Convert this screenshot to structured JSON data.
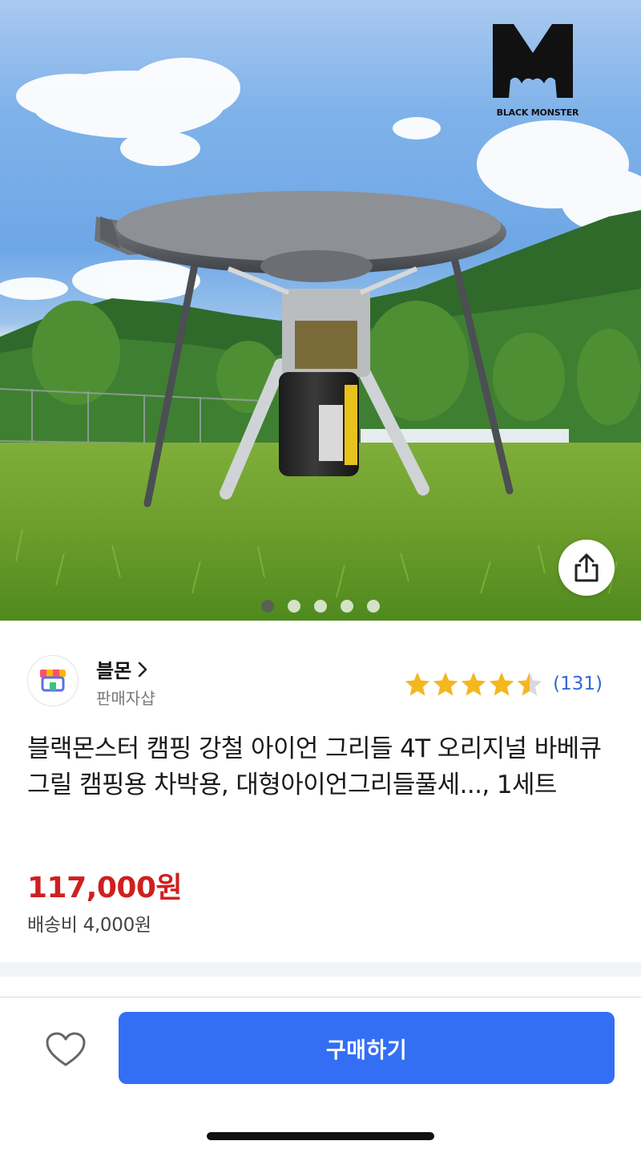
{
  "product_image": {
    "brand_logo_text": "BLACK MONSTER",
    "carousel": {
      "total": 5,
      "active_index": 0
    },
    "share_icon": "share-icon"
  },
  "seller": {
    "name": "블몬",
    "chevron": "chevron-right-icon",
    "type": "판매자샵",
    "avatar_icon": "store-icon"
  },
  "rating": {
    "score": 4.5,
    "max": 5,
    "review_count": "(131)",
    "star_color": "#f5b71f"
  },
  "product": {
    "title": "블랙몬스터 캠핑 강철 아이언 그리들 4T 오리지널 바베큐 그릴 캠핑용 차박용, 대형아이언그리들풀세..., 1세트",
    "price": "117,000원",
    "shipping": "배송비 4,000원"
  },
  "actions": {
    "wish_icon": "heart-outline-icon",
    "buy_label": "구매하기",
    "buy_color": "#336ef5"
  }
}
